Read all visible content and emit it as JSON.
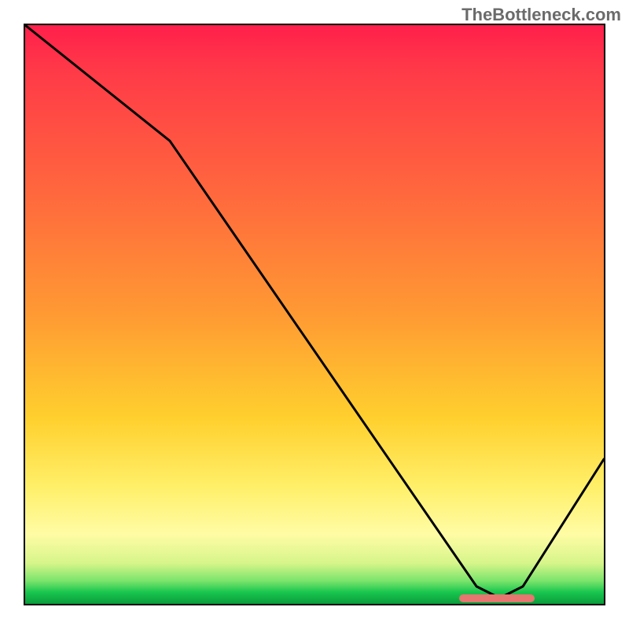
{
  "attribution": "TheBottleneck.com",
  "chart_data": {
    "type": "line",
    "title": "",
    "xlabel": "",
    "ylabel": "",
    "xlim": [
      0,
      100
    ],
    "ylim": [
      0,
      100
    ],
    "series": [
      {
        "name": "curve",
        "x": [
          0,
          25,
          78,
          82,
          86,
          100
        ],
        "values": [
          100,
          80,
          3,
          1,
          3,
          25
        ]
      }
    ],
    "marker": {
      "x_start": 75,
      "x_end": 88,
      "y": 1,
      "color": "#e6766f"
    },
    "background_gradient": {
      "direction": "vertical",
      "stops": [
        {
          "pos": 0,
          "color": "#ff1f4b"
        },
        {
          "pos": 8,
          "color": "#ff3a48"
        },
        {
          "pos": 30,
          "color": "#ff6a3d"
        },
        {
          "pos": 50,
          "color": "#ff9a33"
        },
        {
          "pos": 68,
          "color": "#ffd02e"
        },
        {
          "pos": 80,
          "color": "#fff06a"
        },
        {
          "pos": 88,
          "color": "#fffca5"
        },
        {
          "pos": 93,
          "color": "#d6f58a"
        },
        {
          "pos": 96,
          "color": "#7ce46c"
        },
        {
          "pos": 98,
          "color": "#18c64e"
        },
        {
          "pos": 100,
          "color": "#0a9d3c"
        }
      ]
    }
  }
}
